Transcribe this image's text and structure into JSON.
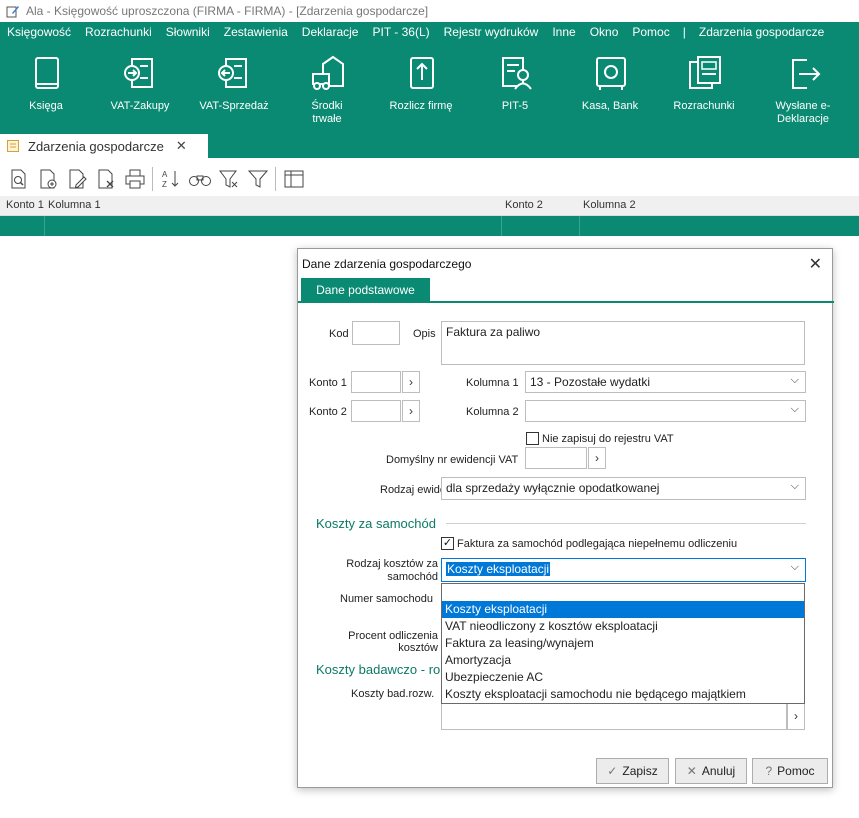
{
  "window": {
    "title": "Ala - Księgowość uproszczona (FIRMA - FIRMA) - [Zdarzenia gospodarcze]"
  },
  "menu": [
    "Księgowość",
    "Rozrachunki",
    "Słowniki",
    "Zestawienia",
    "Deklaracje",
    "PIT - 36(L)",
    "Rejestr wydruków",
    "Inne",
    "Okno",
    "Pomoc",
    "|",
    "Zdarzenia gospodarcze"
  ],
  "ribbon": [
    {
      "label": "Księga",
      "icon": "book-icon"
    },
    {
      "label": "VAT-Zakupy",
      "icon": "vat-purchase-icon"
    },
    {
      "label": "VAT-Sprzedaż",
      "icon": "vat-sales-icon"
    },
    {
      "label": "Środki trwałe",
      "icon": "fixed-assets-icon"
    },
    {
      "label": "Rozlicz firmę",
      "icon": "settle-company-icon"
    },
    {
      "label": "PIT-5",
      "icon": "pit-icon"
    },
    {
      "label": "Kasa, Bank",
      "icon": "safe-icon"
    },
    {
      "label": "Rozrachunki",
      "icon": "settlements-icon"
    },
    {
      "label": "Wysłane e-Deklaracje",
      "icon": "export-icon"
    }
  ],
  "doc_tab": {
    "label": "Zdarzenia gospodarcze"
  },
  "toolbar_icons": [
    "preview-icon",
    "add-document-icon",
    "edit-document-icon",
    "delete-document-icon",
    "print-icon",
    "sort-az-icon",
    "binoculars-icon",
    "filter-clear-icon",
    "filter-icon",
    "columns-icon"
  ],
  "grid": {
    "columns": [
      "Konto 1",
      "Kolumna 1",
      "Konto 2",
      "Kolumna 2"
    ]
  },
  "dialog": {
    "title": "Dane zdarzenia gospodarczego",
    "tab": "Dane podstawowe",
    "kod_label": "Kod",
    "kod_value": "",
    "opis_label": "Opis",
    "opis_value": "Faktura za paliwo",
    "konto1_label": "Konto 1",
    "konto1_value": "",
    "konto2_label": "Konto 2",
    "konto2_value": "",
    "kolumna1_label": "Kolumna 1",
    "kolumna1_value": "13 - Pozostałe wydatki",
    "kolumna2_label": "Kolumna 2",
    "kolumna2_value": "",
    "nie_zapisuj_label": "Nie zapisuj do rejestru VAT",
    "nie_zapisuj_checked": false,
    "nr_ewid_label": "Domyślny nr ewidencji VAT",
    "nr_ewid_value": "",
    "rodzaj_ewid_label": "Rodzaj ewidencji",
    "rodzaj_ewid_value": "dla sprzedaży wyłącznie opodatkowanej",
    "section_koszty": "Koszty za samochód",
    "faktura_samochod_label": "Faktura za samochód podlegająca niepełnemu odliczeniu",
    "faktura_samochod_checked": true,
    "rodzaj_kosztow_label_1": "Rodzaj kosztów za",
    "rodzaj_kosztow_label_2": "samochód",
    "rodzaj_kosztow_value": "Koszty eksploatacji",
    "numer_samochodu_label": "Numer samochodu",
    "procent_label_1": "Procent odliczenia",
    "procent_label_2": "kosztów",
    "section_badawcze": "Koszty badawczo - ro",
    "koszty_bad_label": "Koszty bad.rozw.",
    "dropdown_options": [
      "",
      "Koszty eksploatacji",
      "VAT nieodliczony z kosztów eksploatacji",
      "Faktura za leasing/wynajem",
      "Amortyzacja",
      "Ubezpieczenie AC",
      "Koszty eksploatacji samochodu nie będącego majątkiem"
    ],
    "dropdown_selected_index": 1,
    "btn_zapisz": "Zapisz",
    "btn_anuluj": "Anuluj",
    "btn_pomoc": "Pomoc"
  },
  "colors": {
    "accent": "#0b8a73",
    "selection": "#0078d7"
  }
}
